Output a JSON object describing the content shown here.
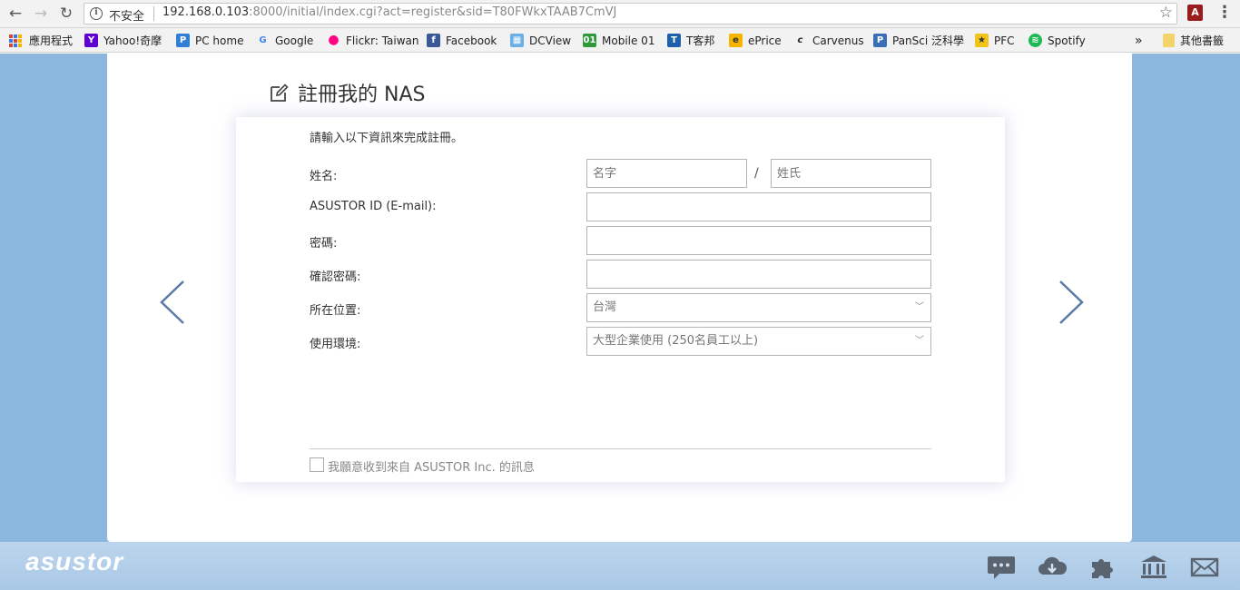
{
  "browser": {
    "security_label": "不安全",
    "url_host": "192.168.0.103",
    "url_rest": ":8000/initial/index.cgi?act=register&sid=T80FWkxTAAB7CmVJ",
    "bookmarks": [
      {
        "label": "應用程式",
        "icon": "apps-icon"
      },
      {
        "label": "Yahoo!奇摩",
        "icon": "yahoo-icon"
      },
      {
        "label": "PC home",
        "icon": "pchome-icon"
      },
      {
        "label": "Google",
        "icon": "google-icon"
      },
      {
        "label": "Flickr: Taiwan",
        "icon": "flickr-icon"
      },
      {
        "label": "Facebook",
        "icon": "facebook-icon"
      },
      {
        "label": "DCView",
        "icon": "dcview-icon"
      },
      {
        "label": "Mobile 01",
        "icon": "mobile01-icon"
      },
      {
        "label": "T客邦",
        "icon": "tkb-icon"
      },
      {
        "label": "ePrice",
        "icon": "eprice-icon"
      },
      {
        "label": "Carvenus",
        "icon": "carvenus-icon"
      },
      {
        "label": "PanSci 泛科學",
        "icon": "pansci-icon"
      },
      {
        "label": "PFC",
        "icon": "pfc-icon"
      },
      {
        "label": "Spotify",
        "icon": "spotify-icon"
      },
      {
        "label": "»",
        "icon": "more-icon"
      },
      {
        "label": "其他書籤",
        "icon": "folder-icon"
      }
    ]
  },
  "form": {
    "title": "註冊我的 NAS",
    "intro": "請輸入以下資訊來完成註冊。",
    "name_label": "姓名:",
    "first_name_placeholder": "名字",
    "last_name_placeholder": "姓氏",
    "name_separator": "/",
    "id_label": "ASUSTOR ID (E-mail):",
    "password_label": "密碼:",
    "confirm_label": "確認密碼:",
    "location_label": "所在位置:",
    "location_value": "台灣",
    "usage_label": "使用環境:",
    "usage_value": "大型企業使用 (250名員工以上)",
    "newsletter_label": "我願意收到來自 ASUSTOR Inc. 的訊息"
  },
  "footer": {
    "logo": "asustor"
  },
  "colors": {
    "page_background": "#8bb7de",
    "footer_background": "#b4d0ea",
    "arrow": "#5a7aa8"
  }
}
